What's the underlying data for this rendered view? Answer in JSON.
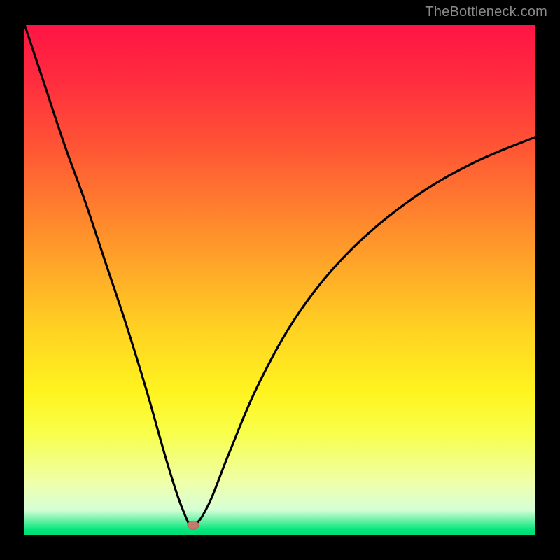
{
  "watermark": "TheBottleneck.com",
  "chart_data": {
    "type": "line",
    "title": "",
    "xlabel": "",
    "ylabel": "",
    "xlim": [
      0,
      100
    ],
    "ylim": [
      0,
      100
    ],
    "grid": false,
    "legend": false,
    "marker": {
      "x": 33,
      "y": 2
    },
    "series": [
      {
        "name": "bottleneck-curve",
        "x": [
          0,
          4,
          8,
          12,
          16,
          20,
          24,
          28,
          31,
          33,
          36,
          40,
          46,
          54,
          64,
          76,
          88,
          100
        ],
        "y": [
          100,
          88,
          76,
          65,
          53,
          41,
          28,
          14,
          5,
          2,
          6,
          16,
          30,
          44,
          56,
          66,
          73,
          78
        ]
      }
    ],
    "background_gradient": {
      "stops": [
        {
          "pos": 0.0,
          "color": "#ff1445"
        },
        {
          "pos": 0.36,
          "color": "#ff7f2e"
        },
        {
          "pos": 0.72,
          "color": "#fff41f"
        },
        {
          "pos": 0.95,
          "color": "#d6ffd6"
        },
        {
          "pos": 1.0,
          "color": "#00dd76"
        }
      ]
    }
  }
}
